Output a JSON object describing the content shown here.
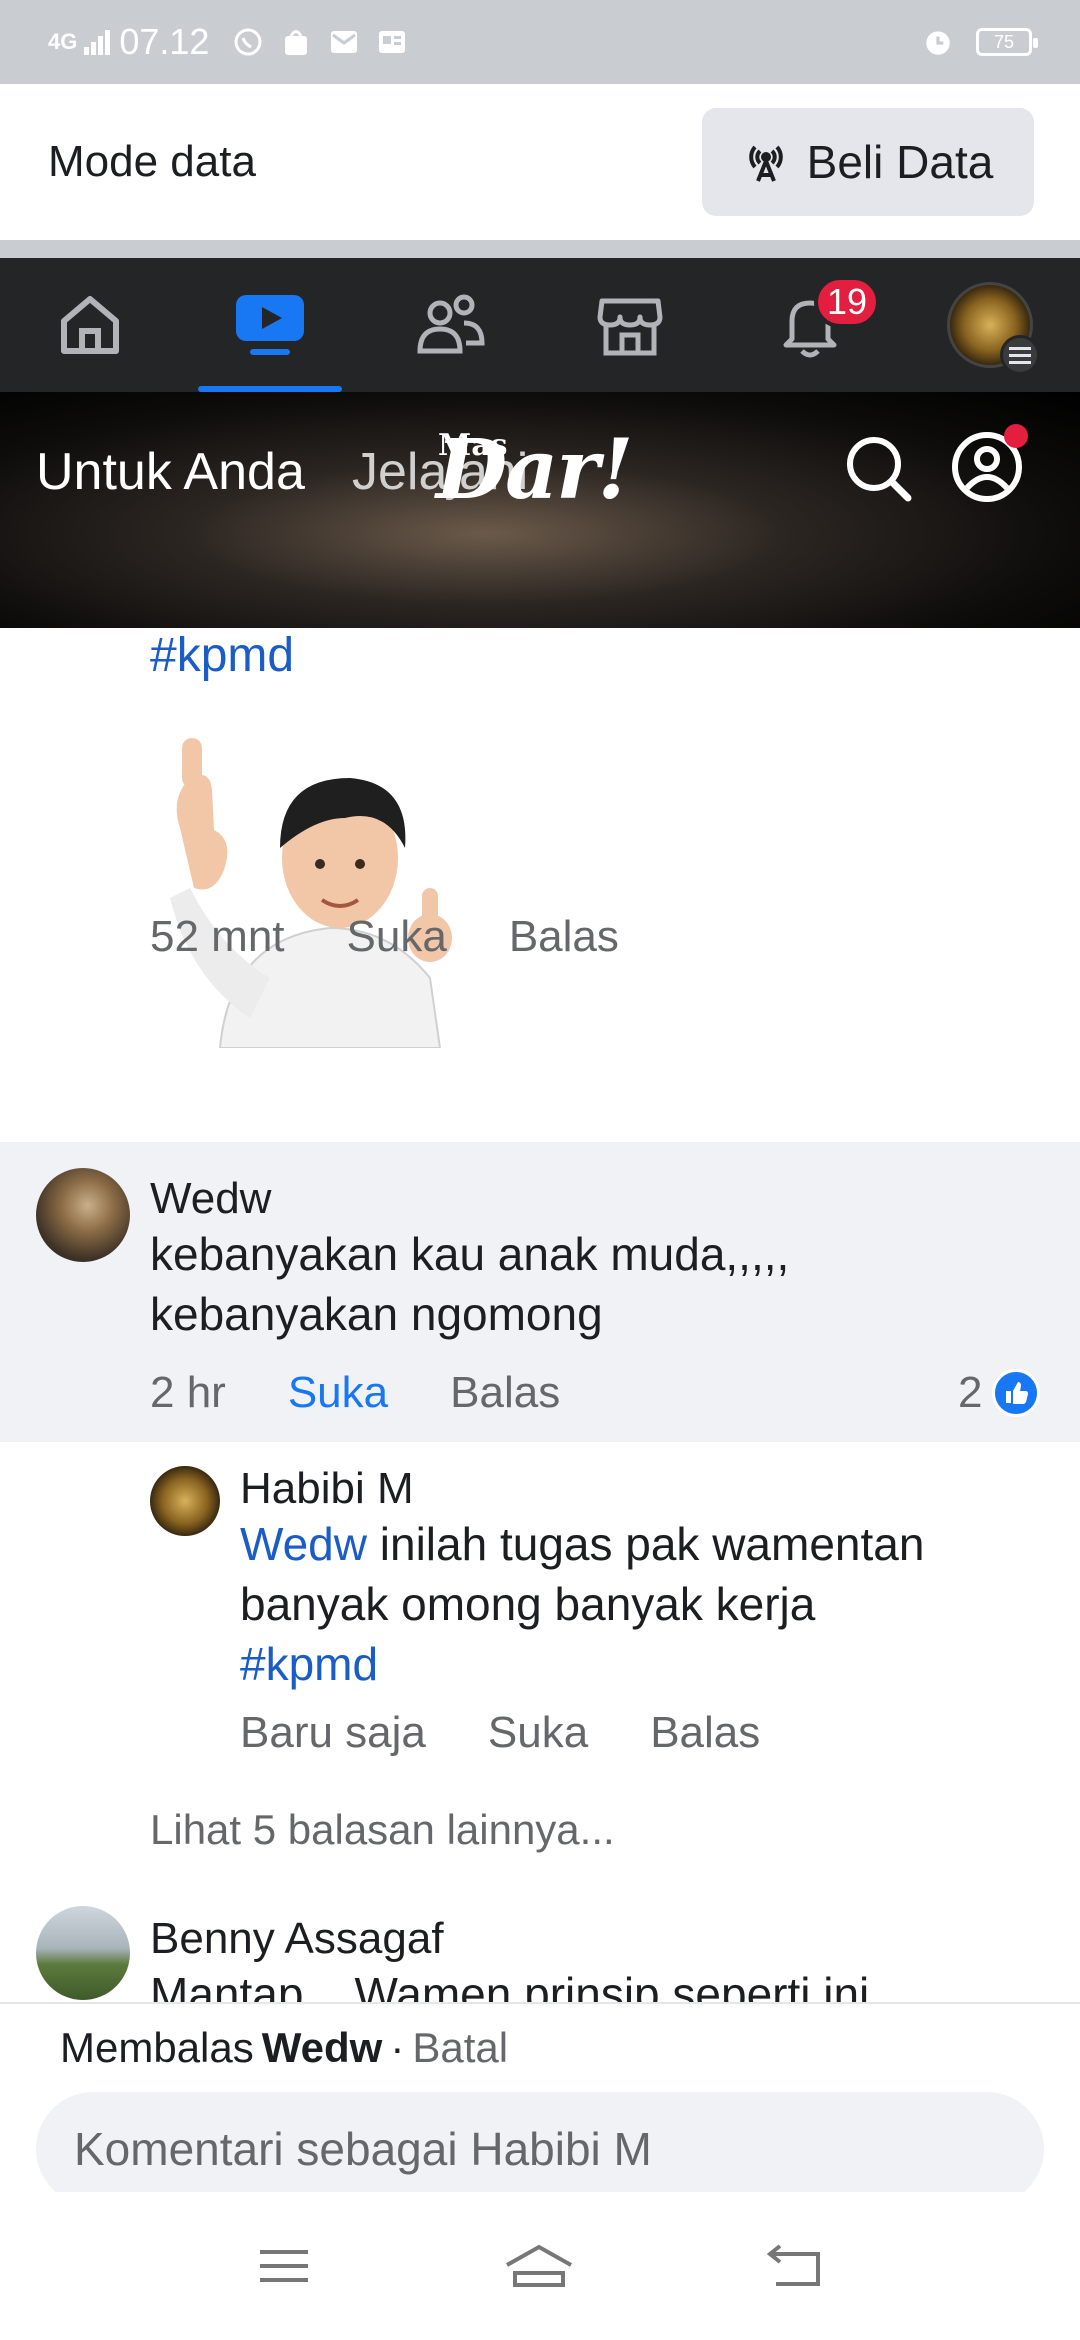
{
  "status_bar": {
    "network": "4G",
    "time": "07.12",
    "battery": "75"
  },
  "data_mode": {
    "label": "Mode data",
    "buy_button": "Beli Data"
  },
  "nav": {
    "notifications_badge": "19"
  },
  "video_header": {
    "tab_for_you": "Untuk Anda",
    "tab_explore": "Jelajahi",
    "brand_small": "Mas",
    "brand_main": "Dar!"
  },
  "comments": {
    "top": {
      "hashtag": "#kpmd",
      "time": "52 mnt",
      "like": "Suka",
      "reply": "Balas"
    },
    "wedw": {
      "name": "Wedw",
      "text_line1": "kebanyakan kau anak muda,,,,,",
      "text_line2": "kebanyakan ngomong",
      "time": "2 hr",
      "like": "Suka",
      "reply": "Balas",
      "like_count": "2"
    },
    "habibi": {
      "name": "Habibi M",
      "mention": "Wedw",
      "text_line1": "inilah tugas pak wamentan",
      "text_line2": "banyak omong banyak kerja",
      "hashtag": "#kpmd",
      "time": "Baru saja",
      "like": "Suka",
      "reply": "Balas"
    },
    "more_replies": "Lihat 5 balasan lainnya...",
    "benny": {
      "name": "Benny Assagaf",
      "text": "Mantap... Wamen prinsip seperti ini"
    }
  },
  "reply_bar": {
    "prefix": "Membalas",
    "target": "Wedw",
    "separator": "·",
    "cancel": "Batal",
    "placeholder": "Komentari sebagai Habibi M"
  },
  "colors": {
    "accent": "#1877f2",
    "nav_bg": "#242526",
    "badge": "#e41e3f",
    "hashtag": "#1a5cc8"
  }
}
